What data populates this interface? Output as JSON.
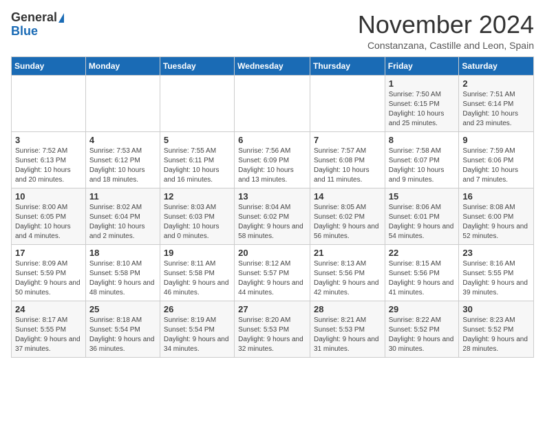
{
  "header": {
    "logo_line1": "General",
    "logo_line2": "Blue",
    "month": "November 2024",
    "location": "Constanzana, Castille and Leon, Spain"
  },
  "days_of_week": [
    "Sunday",
    "Monday",
    "Tuesday",
    "Wednesday",
    "Thursday",
    "Friday",
    "Saturday"
  ],
  "weeks": [
    [
      {
        "day": "",
        "info": ""
      },
      {
        "day": "",
        "info": ""
      },
      {
        "day": "",
        "info": ""
      },
      {
        "day": "",
        "info": ""
      },
      {
        "day": "",
        "info": ""
      },
      {
        "day": "1",
        "info": "Sunrise: 7:50 AM\nSunset: 6:15 PM\nDaylight: 10 hours and 25 minutes."
      },
      {
        "day": "2",
        "info": "Sunrise: 7:51 AM\nSunset: 6:14 PM\nDaylight: 10 hours and 23 minutes."
      }
    ],
    [
      {
        "day": "3",
        "info": "Sunrise: 7:52 AM\nSunset: 6:13 PM\nDaylight: 10 hours and 20 minutes."
      },
      {
        "day": "4",
        "info": "Sunrise: 7:53 AM\nSunset: 6:12 PM\nDaylight: 10 hours and 18 minutes."
      },
      {
        "day": "5",
        "info": "Sunrise: 7:55 AM\nSunset: 6:11 PM\nDaylight: 10 hours and 16 minutes."
      },
      {
        "day": "6",
        "info": "Sunrise: 7:56 AM\nSunset: 6:09 PM\nDaylight: 10 hours and 13 minutes."
      },
      {
        "day": "7",
        "info": "Sunrise: 7:57 AM\nSunset: 6:08 PM\nDaylight: 10 hours and 11 minutes."
      },
      {
        "day": "8",
        "info": "Sunrise: 7:58 AM\nSunset: 6:07 PM\nDaylight: 10 hours and 9 minutes."
      },
      {
        "day": "9",
        "info": "Sunrise: 7:59 AM\nSunset: 6:06 PM\nDaylight: 10 hours and 7 minutes."
      }
    ],
    [
      {
        "day": "10",
        "info": "Sunrise: 8:00 AM\nSunset: 6:05 PM\nDaylight: 10 hours and 4 minutes."
      },
      {
        "day": "11",
        "info": "Sunrise: 8:02 AM\nSunset: 6:04 PM\nDaylight: 10 hours and 2 minutes."
      },
      {
        "day": "12",
        "info": "Sunrise: 8:03 AM\nSunset: 6:03 PM\nDaylight: 10 hours and 0 minutes."
      },
      {
        "day": "13",
        "info": "Sunrise: 8:04 AM\nSunset: 6:02 PM\nDaylight: 9 hours and 58 minutes."
      },
      {
        "day": "14",
        "info": "Sunrise: 8:05 AM\nSunset: 6:02 PM\nDaylight: 9 hours and 56 minutes."
      },
      {
        "day": "15",
        "info": "Sunrise: 8:06 AM\nSunset: 6:01 PM\nDaylight: 9 hours and 54 minutes."
      },
      {
        "day": "16",
        "info": "Sunrise: 8:08 AM\nSunset: 6:00 PM\nDaylight: 9 hours and 52 minutes."
      }
    ],
    [
      {
        "day": "17",
        "info": "Sunrise: 8:09 AM\nSunset: 5:59 PM\nDaylight: 9 hours and 50 minutes."
      },
      {
        "day": "18",
        "info": "Sunrise: 8:10 AM\nSunset: 5:58 PM\nDaylight: 9 hours and 48 minutes."
      },
      {
        "day": "19",
        "info": "Sunrise: 8:11 AM\nSunset: 5:58 PM\nDaylight: 9 hours and 46 minutes."
      },
      {
        "day": "20",
        "info": "Sunrise: 8:12 AM\nSunset: 5:57 PM\nDaylight: 9 hours and 44 minutes."
      },
      {
        "day": "21",
        "info": "Sunrise: 8:13 AM\nSunset: 5:56 PM\nDaylight: 9 hours and 42 minutes."
      },
      {
        "day": "22",
        "info": "Sunrise: 8:15 AM\nSunset: 5:56 PM\nDaylight: 9 hours and 41 minutes."
      },
      {
        "day": "23",
        "info": "Sunrise: 8:16 AM\nSunset: 5:55 PM\nDaylight: 9 hours and 39 minutes."
      }
    ],
    [
      {
        "day": "24",
        "info": "Sunrise: 8:17 AM\nSunset: 5:55 PM\nDaylight: 9 hours and 37 minutes."
      },
      {
        "day": "25",
        "info": "Sunrise: 8:18 AM\nSunset: 5:54 PM\nDaylight: 9 hours and 36 minutes."
      },
      {
        "day": "26",
        "info": "Sunrise: 8:19 AM\nSunset: 5:54 PM\nDaylight: 9 hours and 34 minutes."
      },
      {
        "day": "27",
        "info": "Sunrise: 8:20 AM\nSunset: 5:53 PM\nDaylight: 9 hours and 32 minutes."
      },
      {
        "day": "28",
        "info": "Sunrise: 8:21 AM\nSunset: 5:53 PM\nDaylight: 9 hours and 31 minutes."
      },
      {
        "day": "29",
        "info": "Sunrise: 8:22 AM\nSunset: 5:52 PM\nDaylight: 9 hours and 30 minutes."
      },
      {
        "day": "30",
        "info": "Sunrise: 8:23 AM\nSunset: 5:52 PM\nDaylight: 9 hours and 28 minutes."
      }
    ]
  ]
}
